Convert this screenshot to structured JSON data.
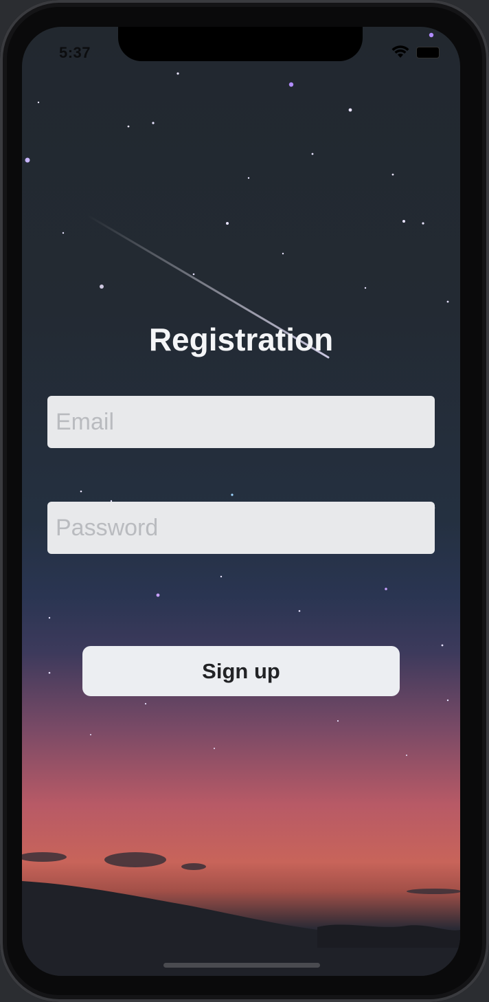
{
  "status_bar": {
    "time": "5:37",
    "icons": [
      "wifi-icon",
      "battery-icon"
    ]
  },
  "form": {
    "title": "Registration",
    "email_placeholder": "Email",
    "email_value": "",
    "password_placeholder": "Password",
    "password_value": "",
    "signup_label": "Sign up"
  },
  "colors": {
    "title_text": "#f4f5f7",
    "field_background": "#e8e9eb",
    "placeholder_text": "#b9bbbf",
    "button_background": "#eceef2",
    "button_text": "#222326"
  }
}
